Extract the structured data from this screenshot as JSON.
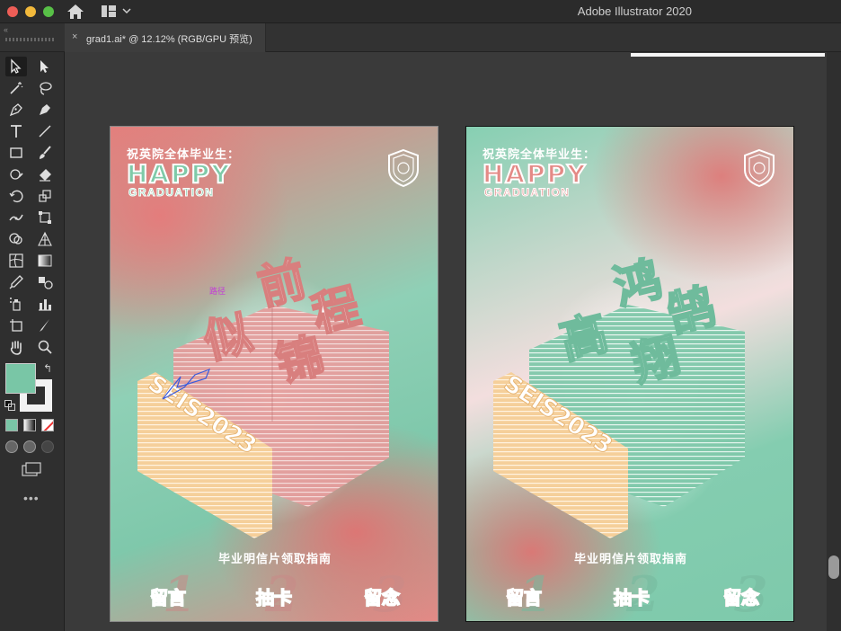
{
  "window": {
    "app_title": "Adobe Illustrator 2020"
  },
  "tab": {
    "label": "grad1.ai* @ 12.12% (RGB/GPU 预览)",
    "close_glyph": "×"
  },
  "toolbar": {
    "collapse_glyph": "‹‹",
    "swap_glyph": "↰",
    "more_glyph": "•••",
    "fill_color": "#79c6a6",
    "stroke_color": "#f2f2f2",
    "tools": [
      "selection-tool",
      "direct-selection-tool",
      "magic-wand-tool",
      "lasso-tool",
      "pen-tool",
      "curvature-tool",
      "type-tool",
      "line-segment-tool",
      "rectangle-tool",
      "paintbrush-tool",
      "shaper-tool",
      "eraser-tool",
      "rotate-tool",
      "scale-tool",
      "width-tool",
      "free-transform-tool",
      "shape-builder-tool",
      "perspective-grid-tool",
      "mesh-tool",
      "gradient-tool",
      "eyedropper-tool",
      "blend-tool",
      "symbol-sprayer-tool",
      "column-graph-tool",
      "artboard-tool",
      "slice-tool",
      "hand-tool",
      "zoom-tool"
    ]
  },
  "artboards": [
    {
      "greeting": "祝英院全体毕业生：",
      "happy": "HAPPY",
      "graduation": "GRADUATION",
      "title_chars": [
        "前",
        "程",
        "似",
        "锦"
      ],
      "year_text": "SEIS2023",
      "guide": "毕业明信片领取指南",
      "path_label": "路径",
      "options": [
        {
          "num": "1",
          "label": "留言"
        },
        {
          "num": "2",
          "label": "抽卡"
        },
        {
          "num": "3",
          "label": "留念"
        }
      ],
      "colors": {
        "block": "#e08c8c",
        "stripe": "#9fd6c2",
        "year": "#f5cf9a"
      }
    },
    {
      "greeting": "祝英院全体毕业生：",
      "happy": "HAPPY",
      "graduation": "GRADUATION",
      "title_chars": [
        "鸿",
        "鹄",
        "高",
        "翔"
      ],
      "year_text": "SEIS2023",
      "guide": "毕业明信片领取指南",
      "options": [
        {
          "num": "1",
          "label": "留言"
        },
        {
          "num": "2",
          "label": "抽卡"
        },
        {
          "num": "3",
          "label": "留念"
        }
      ],
      "colors": {
        "block": "#79c6a6",
        "stripe": "#ffffff",
        "year": "#f5cf9a"
      }
    }
  ]
}
